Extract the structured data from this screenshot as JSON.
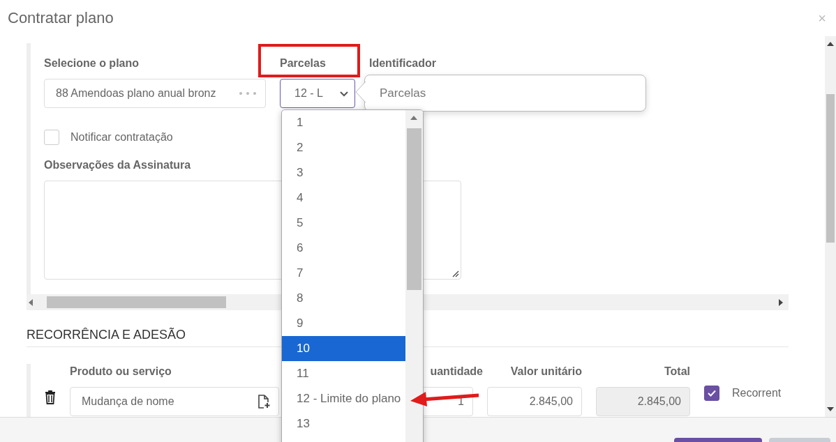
{
  "window": {
    "title": "Contratar plano",
    "close": "×"
  },
  "plan": {
    "label": "Selecione o plano",
    "value": "88 Amendoas plano anual bronz"
  },
  "installments": {
    "label": "Parcelas",
    "value": "12 - L"
  },
  "identifier": {
    "label": "Identificador"
  },
  "tooltip": {
    "text": "Parcelas"
  },
  "notify": {
    "label": "Notificar contratação",
    "checked": false
  },
  "notes": {
    "label": "Observações da Assinatura"
  },
  "section_title": "RECORRÊNCIA E ADESÃO",
  "product": {
    "label": "Produto ou serviço",
    "value": "Mudança de nome"
  },
  "quantity": {
    "label": "uantidade",
    "value": "1"
  },
  "unit_price": {
    "label": "Valor unitário",
    "value": "2.845,00"
  },
  "total": {
    "label": "Total",
    "value": "2.845,00"
  },
  "recurring": {
    "label": "Recorrent",
    "checked": true
  },
  "dropdown": [
    {
      "label": "1",
      "selected": false
    },
    {
      "label": "2",
      "selected": false
    },
    {
      "label": "3",
      "selected": false
    },
    {
      "label": "4",
      "selected": false
    },
    {
      "label": "5",
      "selected": false
    },
    {
      "label": "6",
      "selected": false
    },
    {
      "label": "7",
      "selected": false
    },
    {
      "label": "8",
      "selected": false
    },
    {
      "label": "9",
      "selected": false
    },
    {
      "label": "10",
      "selected": true
    },
    {
      "label": "11",
      "selected": false
    },
    {
      "label": "12 - Limite do plano",
      "selected": false
    },
    {
      "label": "13",
      "selected": false
    }
  ]
}
